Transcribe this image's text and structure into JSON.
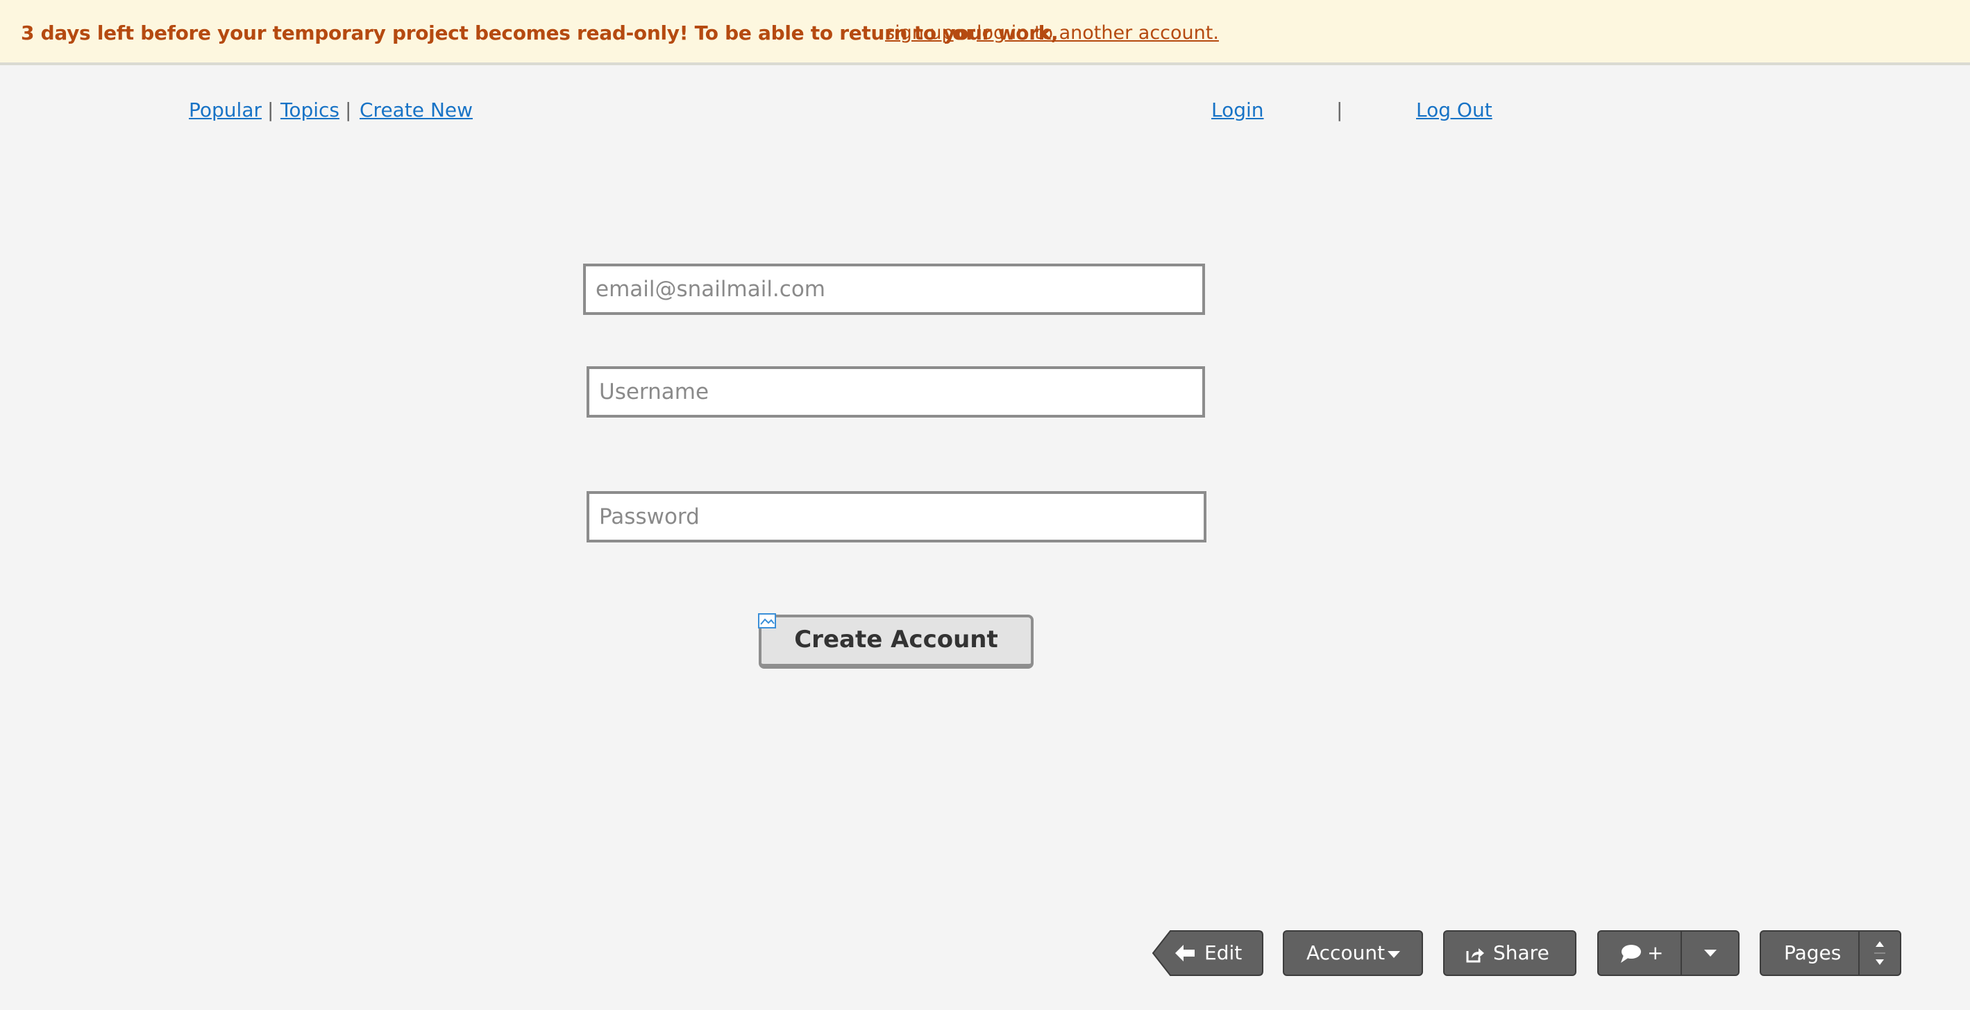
{
  "banner": {
    "message": "3 days left before your temporary project becomes read-only! To be able to return to your work,",
    "signup_label": "sign up",
    "or_label": "or",
    "login_other_label": "log in to another account."
  },
  "nav": {
    "popular": "Popular",
    "topics": "Topics",
    "create_new": "Create New",
    "separator": "|",
    "login": "Login",
    "logout": "Log Out"
  },
  "form": {
    "email_placeholder": "email@snailmail.com",
    "username_placeholder": "Username",
    "password_placeholder": "Password",
    "submit_label": "Create Account"
  },
  "toolbar": {
    "edit_label": "Edit",
    "account_label": "Account",
    "share_label": "Share",
    "comment_label": "+",
    "pages_label": "Pages"
  },
  "colors": {
    "banner_bg": "#fdf7df",
    "banner_text": "#b54a10",
    "link": "#1873c6",
    "toolbar_bg": "#616161",
    "page_bg": "#f4f4f4"
  },
  "icons": {
    "edit": "arrow-left-icon",
    "account": "caret-down-icon",
    "share": "share-icon",
    "comment": "speech-bubble-icon",
    "more": "caret-down-icon",
    "pages": "up-down-arrows-icon",
    "button_marker": "image-placeholder-icon"
  }
}
